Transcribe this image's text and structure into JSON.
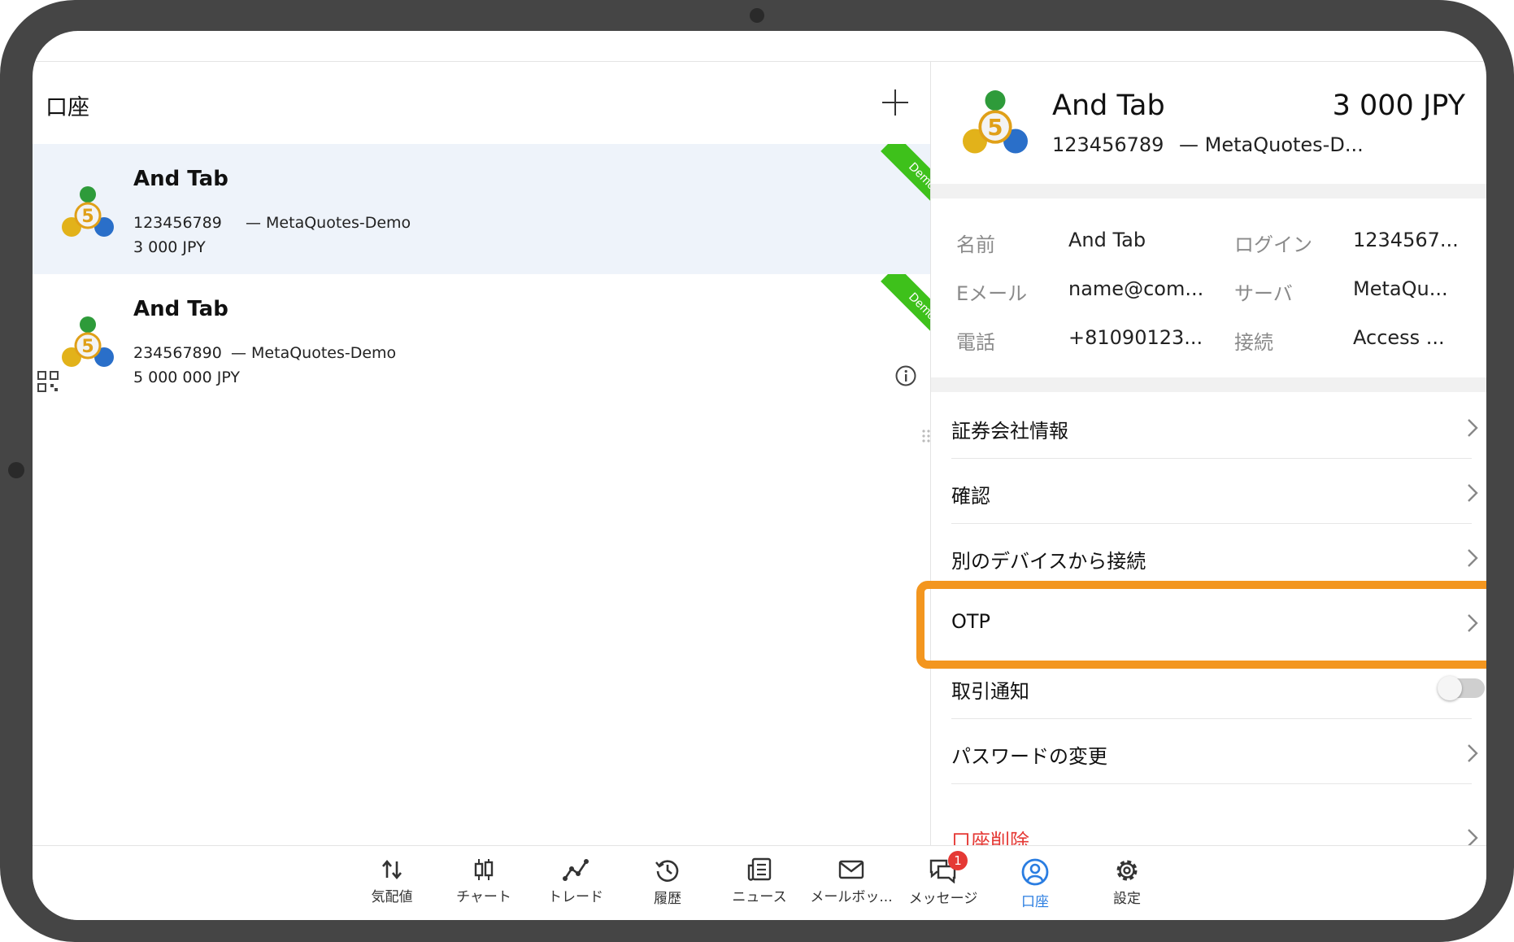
{
  "left_panel": {
    "title": "口座",
    "accounts": [
      {
        "name": "And Tab",
        "number": "123456789",
        "server": "— MetaQuotes-Demo",
        "balance": "3 000 JPY",
        "badge": "Demo",
        "selected": true
      },
      {
        "name": "And Tab",
        "number": "234567890",
        "server": "— MetaQuotes-Demo",
        "balance": "5 000 000 JPY",
        "badge": "Demo",
        "selected": false
      }
    ]
  },
  "right_panel": {
    "header": {
      "name": "And Tab",
      "balance": "3 000 JPY",
      "number": "123456789",
      "server": "— MetaQuotes-D..."
    },
    "details": [
      {
        "label": "名前",
        "value": "And Tab"
      },
      {
        "label": "ログイン",
        "value": "1234567..."
      },
      {
        "label": "Eメール",
        "value": "name@com..."
      },
      {
        "label": "サーバ",
        "value": "MetaQu..."
      },
      {
        "label": "電話",
        "value": "+81090123..."
      },
      {
        "label": "接続",
        "value": "Access ..."
      }
    ],
    "menu": [
      {
        "label": "証券会社情報"
      },
      {
        "label": "確認"
      },
      {
        "label": "別のデバイスから接続"
      },
      {
        "label": "OTP"
      },
      {
        "label": "取引通知"
      },
      {
        "label": "パスワードの変更"
      },
      {
        "label": "口座削除"
      }
    ],
    "trade_notifications_enabled": false
  },
  "bottom_nav": {
    "items": [
      {
        "label": "気配値",
        "icon": "quotes-arrows-icon"
      },
      {
        "label": "チャート",
        "icon": "candlestick-icon"
      },
      {
        "label": "トレード",
        "icon": "trade-line-icon"
      },
      {
        "label": "履歴",
        "icon": "history-clock-icon"
      },
      {
        "label": "ニュース",
        "icon": "news-icon"
      },
      {
        "label": "メールボッ...",
        "icon": "mail-icon"
      },
      {
        "label": "メッセージ",
        "icon": "chat-icon",
        "badge": "1"
      },
      {
        "label": "口座",
        "icon": "account-icon",
        "active": true
      },
      {
        "label": "設定",
        "icon": "gear-icon"
      }
    ]
  },
  "colors": {
    "accent": "#2a7de1",
    "highlight": "#f3961f",
    "demo_badge": "#3ec11b",
    "danger": "#e53935",
    "selected_row": "#eef3fa"
  }
}
